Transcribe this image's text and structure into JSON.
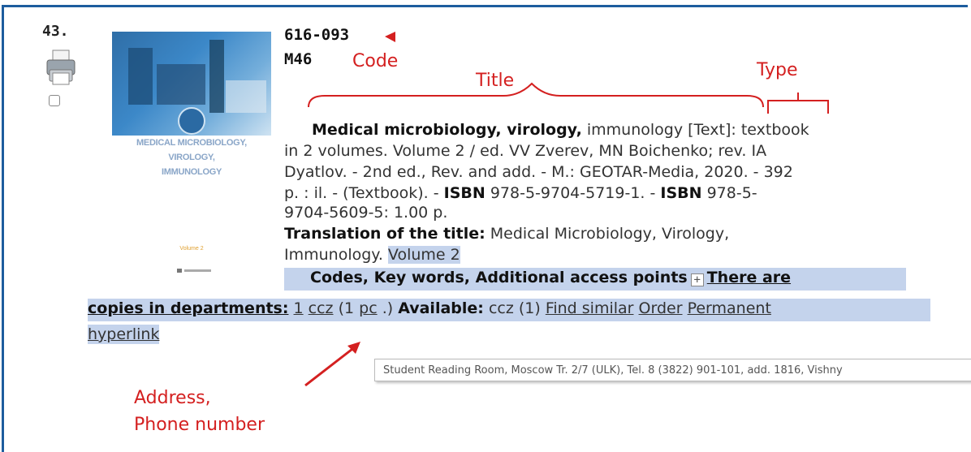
{
  "item": {
    "number": "43.",
    "code_line1": "616-093",
    "code_line2": "M46"
  },
  "cover": {
    "title_lines": [
      "MEDICAL MICROBIOLOGY,",
      "VIROLOGY,",
      "IMMUNOLOGY"
    ],
    "volume": "Volume 2"
  },
  "annotations": {
    "code": "Code",
    "title": "Title",
    "type": "Type",
    "address_line1": "Address,",
    "address_line2": "Phone number",
    "color": "#d42020"
  },
  "record": {
    "title_bold": "Medical microbiology, virology,",
    "title_rest": " immunology ",
    "type": "[Text]",
    "line1_rest": ": textbook",
    "line2": "in 2 volumes. Volume 2 / ed. VV Zverev, MN Boichenko; rev. IA",
    "line3": "Dyatlov. - 2nd ed., Rev. and add. - M.: GEOTAR-Media, 2020. - 392",
    "line4_a": "p. : il. - (Textbook). - ",
    "isbn_label": "ISBN",
    "line4_b": " 978-5-9704-5719-1. - ",
    "line4_c": " 978-5-",
    "line5": "9704-5609-5: 1.00 p.",
    "translation_label": "Translation of the title:",
    "translation_value": " Medical Microbiology, Virology,",
    "translation_line2": "Immunology. ",
    "translation_volume": "Volume 2",
    "codes_label": "Codes, Key words, Additional access points",
    "plus": "+",
    "copies_a": "There are",
    "copies_b": "copies in departments:",
    "copies_count": "1",
    "dept": "ccz",
    "pc_open": "(1",
    "pc": "pc",
    "pc_close": ".)",
    "available_label": "Available:",
    "available_value": "ccz (1)",
    "find_similar": "Find similar",
    "order": "Order",
    "permanent": "Permanent",
    "hyperlink": "hyperlink"
  },
  "tooltip": {
    "text": "Student Reading Room, Moscow Tr. 2/7 (ULK), Tel. 8 (3822) 901-101, add. 1816, Vishny"
  },
  "colors": {
    "highlight": "#c4d3ec",
    "frame": "#1d5d9e"
  }
}
